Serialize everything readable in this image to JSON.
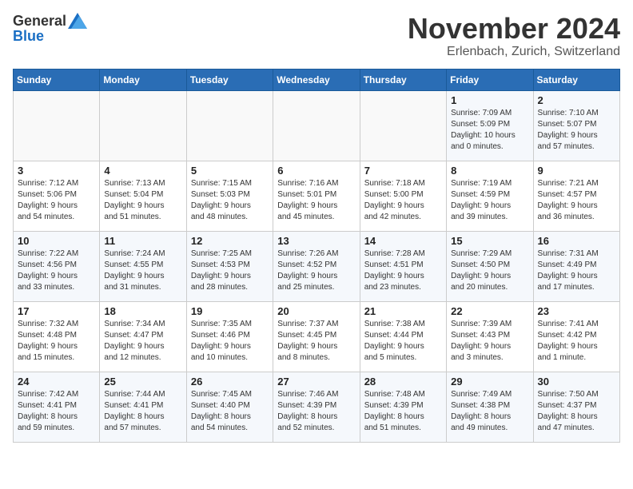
{
  "header": {
    "logo_general": "General",
    "logo_blue": "Blue",
    "month": "November 2024",
    "location": "Erlenbach, Zurich, Switzerland"
  },
  "weekdays": [
    "Sunday",
    "Monday",
    "Tuesday",
    "Wednesday",
    "Thursday",
    "Friday",
    "Saturday"
  ],
  "weeks": [
    [
      {
        "day": "",
        "info": ""
      },
      {
        "day": "",
        "info": ""
      },
      {
        "day": "",
        "info": ""
      },
      {
        "day": "",
        "info": ""
      },
      {
        "day": "",
        "info": ""
      },
      {
        "day": "1",
        "info": "Sunrise: 7:09 AM\nSunset: 5:09 PM\nDaylight: 10 hours\nand 0 minutes."
      },
      {
        "day": "2",
        "info": "Sunrise: 7:10 AM\nSunset: 5:07 PM\nDaylight: 9 hours\nand 57 minutes."
      }
    ],
    [
      {
        "day": "3",
        "info": "Sunrise: 7:12 AM\nSunset: 5:06 PM\nDaylight: 9 hours\nand 54 minutes."
      },
      {
        "day": "4",
        "info": "Sunrise: 7:13 AM\nSunset: 5:04 PM\nDaylight: 9 hours\nand 51 minutes."
      },
      {
        "day": "5",
        "info": "Sunrise: 7:15 AM\nSunset: 5:03 PM\nDaylight: 9 hours\nand 48 minutes."
      },
      {
        "day": "6",
        "info": "Sunrise: 7:16 AM\nSunset: 5:01 PM\nDaylight: 9 hours\nand 45 minutes."
      },
      {
        "day": "7",
        "info": "Sunrise: 7:18 AM\nSunset: 5:00 PM\nDaylight: 9 hours\nand 42 minutes."
      },
      {
        "day": "8",
        "info": "Sunrise: 7:19 AM\nSunset: 4:59 PM\nDaylight: 9 hours\nand 39 minutes."
      },
      {
        "day": "9",
        "info": "Sunrise: 7:21 AM\nSunset: 4:57 PM\nDaylight: 9 hours\nand 36 minutes."
      }
    ],
    [
      {
        "day": "10",
        "info": "Sunrise: 7:22 AM\nSunset: 4:56 PM\nDaylight: 9 hours\nand 33 minutes."
      },
      {
        "day": "11",
        "info": "Sunrise: 7:24 AM\nSunset: 4:55 PM\nDaylight: 9 hours\nand 31 minutes."
      },
      {
        "day": "12",
        "info": "Sunrise: 7:25 AM\nSunset: 4:53 PM\nDaylight: 9 hours\nand 28 minutes."
      },
      {
        "day": "13",
        "info": "Sunrise: 7:26 AM\nSunset: 4:52 PM\nDaylight: 9 hours\nand 25 minutes."
      },
      {
        "day": "14",
        "info": "Sunrise: 7:28 AM\nSunset: 4:51 PM\nDaylight: 9 hours\nand 23 minutes."
      },
      {
        "day": "15",
        "info": "Sunrise: 7:29 AM\nSunset: 4:50 PM\nDaylight: 9 hours\nand 20 minutes."
      },
      {
        "day": "16",
        "info": "Sunrise: 7:31 AM\nSunset: 4:49 PM\nDaylight: 9 hours\nand 17 minutes."
      }
    ],
    [
      {
        "day": "17",
        "info": "Sunrise: 7:32 AM\nSunset: 4:48 PM\nDaylight: 9 hours\nand 15 minutes."
      },
      {
        "day": "18",
        "info": "Sunrise: 7:34 AM\nSunset: 4:47 PM\nDaylight: 9 hours\nand 12 minutes."
      },
      {
        "day": "19",
        "info": "Sunrise: 7:35 AM\nSunset: 4:46 PM\nDaylight: 9 hours\nand 10 minutes."
      },
      {
        "day": "20",
        "info": "Sunrise: 7:37 AM\nSunset: 4:45 PM\nDaylight: 9 hours\nand 8 minutes."
      },
      {
        "day": "21",
        "info": "Sunrise: 7:38 AM\nSunset: 4:44 PM\nDaylight: 9 hours\nand 5 minutes."
      },
      {
        "day": "22",
        "info": "Sunrise: 7:39 AM\nSunset: 4:43 PM\nDaylight: 9 hours\nand 3 minutes."
      },
      {
        "day": "23",
        "info": "Sunrise: 7:41 AM\nSunset: 4:42 PM\nDaylight: 9 hours\nand 1 minute."
      }
    ],
    [
      {
        "day": "24",
        "info": "Sunrise: 7:42 AM\nSunset: 4:41 PM\nDaylight: 8 hours\nand 59 minutes."
      },
      {
        "day": "25",
        "info": "Sunrise: 7:44 AM\nSunset: 4:41 PM\nDaylight: 8 hours\nand 57 minutes."
      },
      {
        "day": "26",
        "info": "Sunrise: 7:45 AM\nSunset: 4:40 PM\nDaylight: 8 hours\nand 54 minutes."
      },
      {
        "day": "27",
        "info": "Sunrise: 7:46 AM\nSunset: 4:39 PM\nDaylight: 8 hours\nand 52 minutes."
      },
      {
        "day": "28",
        "info": "Sunrise: 7:48 AM\nSunset: 4:39 PM\nDaylight: 8 hours\nand 51 minutes."
      },
      {
        "day": "29",
        "info": "Sunrise: 7:49 AM\nSunset: 4:38 PM\nDaylight: 8 hours\nand 49 minutes."
      },
      {
        "day": "30",
        "info": "Sunrise: 7:50 AM\nSunset: 4:37 PM\nDaylight: 8 hours\nand 47 minutes."
      }
    ]
  ]
}
